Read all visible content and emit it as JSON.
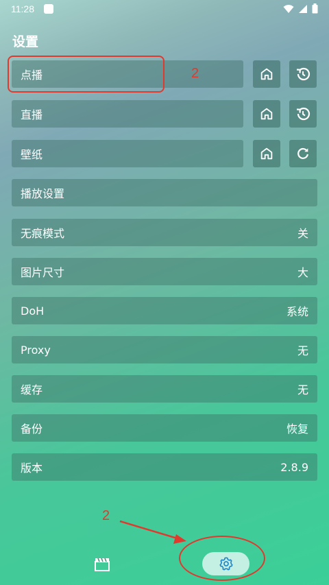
{
  "status": {
    "time": "11:28"
  },
  "page": {
    "title": "设置"
  },
  "rows": {
    "vod": {
      "label": "点播"
    },
    "live": {
      "label": "直播"
    },
    "wallpaper": {
      "label": "壁纸"
    },
    "playback": {
      "label": "播放设置"
    },
    "incognito": {
      "label": "无痕模式",
      "value": "关"
    },
    "image_size": {
      "label": "图片尺寸",
      "value": "大"
    },
    "doh": {
      "label": "DoH",
      "value": "系统"
    },
    "proxy": {
      "label": "Proxy",
      "value": "无"
    },
    "cache": {
      "label": "缓存",
      "value": "无"
    },
    "backup": {
      "label": "备份",
      "value": "恢复"
    },
    "version": {
      "label": "版本",
      "value": "2.8.9"
    }
  },
  "annotations": {
    "top_number": "2",
    "bottom_number": "2",
    "color": "#e03a2e"
  },
  "icons": {
    "home": "home-icon",
    "history": "history-icon",
    "refresh": "refresh-icon",
    "movie": "clapperboard-icon",
    "settings": "gear-icon"
  }
}
